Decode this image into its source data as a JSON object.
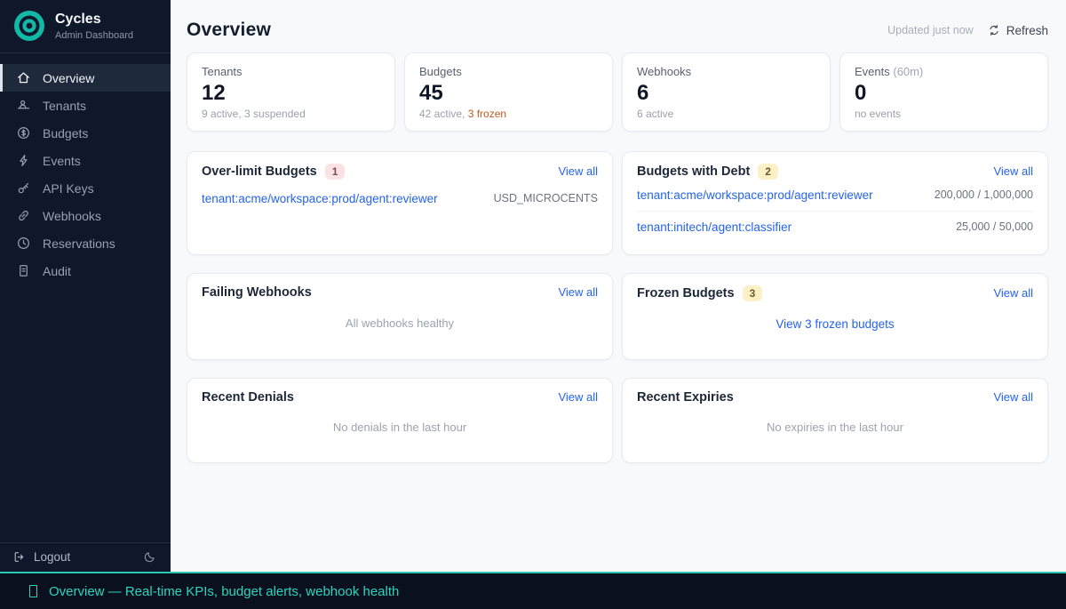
{
  "app": {
    "name": "Cycles",
    "subtitle": "Admin Dashboard"
  },
  "colors": {
    "accent_teal": "#14b8a6",
    "sidebar_bg": "#0f172a",
    "link_blue": "#2563eb",
    "warning_orange": "#c05a21",
    "badge_red_bg": "#fbe3e5",
    "badge_yellow_bg": "#fcf0c6",
    "statusbar_text": "#2dd4bf"
  },
  "sidebar": {
    "items": [
      {
        "label": "Overview",
        "icon": "home-icon",
        "active": true
      },
      {
        "label": "Tenants",
        "icon": "users-icon",
        "active": false
      },
      {
        "label": "Budgets",
        "icon": "dollar-circle-icon",
        "active": false
      },
      {
        "label": "Events",
        "icon": "bolt-icon",
        "active": false
      },
      {
        "label": "API Keys",
        "icon": "key-icon",
        "active": false
      },
      {
        "label": "Webhooks",
        "icon": "link-icon",
        "active": false
      },
      {
        "label": "Reservations",
        "icon": "clock-icon",
        "active": false
      },
      {
        "label": "Audit",
        "icon": "document-icon",
        "active": false
      }
    ],
    "logout_label": "Logout"
  },
  "header": {
    "title": "Overview",
    "updated_text": "Updated just now",
    "refresh_label": "Refresh"
  },
  "stats": [
    {
      "label": "Tenants",
      "label_suffix": "",
      "value": "12",
      "sub_text": "9 active, 3 suspended",
      "sub_highlight": ""
    },
    {
      "label": "Budgets",
      "label_suffix": "",
      "value": "45",
      "sub_text": "42 active, ",
      "sub_highlight": "3 frozen"
    },
    {
      "label": "Webhooks",
      "label_suffix": "",
      "value": "6",
      "sub_text": "6 active",
      "sub_highlight": ""
    },
    {
      "label": "Events",
      "label_suffix": "(60m)",
      "value": "0",
      "sub_text": "no events",
      "sub_highlight": ""
    }
  ],
  "panels": {
    "over_limit": {
      "title": "Over-limit Budgets",
      "badge": "1",
      "view_all": "View all",
      "rows": [
        {
          "link": "tenant:acme/workspace:prod/agent:reviewer",
          "value": "USD_MICROCENTS"
        }
      ]
    },
    "debt": {
      "title": "Budgets with Debt",
      "badge": "2",
      "view_all": "View all",
      "rows": [
        {
          "link": "tenant:acme/workspace:prod/agent:reviewer",
          "value": "200,000 / 1,000,000"
        },
        {
          "link": "tenant:initech/agent:classifier",
          "value": "25,000 / 50,000"
        }
      ]
    },
    "failing_webhooks": {
      "title": "Failing Webhooks",
      "view_all": "View all",
      "empty_text": "All webhooks healthy"
    },
    "frozen": {
      "title": "Frozen Budgets",
      "badge": "3",
      "view_all": "View all",
      "action_link": "View 3 frozen budgets"
    },
    "denials": {
      "title": "Recent Denials",
      "view_all": "View all",
      "empty_text": "No denials in the last hour"
    },
    "expiries": {
      "title": "Recent Expiries",
      "view_all": "View all",
      "empty_text": "No expiries in the last hour"
    }
  },
  "statusbar": {
    "text": "Overview — Real-time KPIs, budget alerts, webhook health"
  }
}
